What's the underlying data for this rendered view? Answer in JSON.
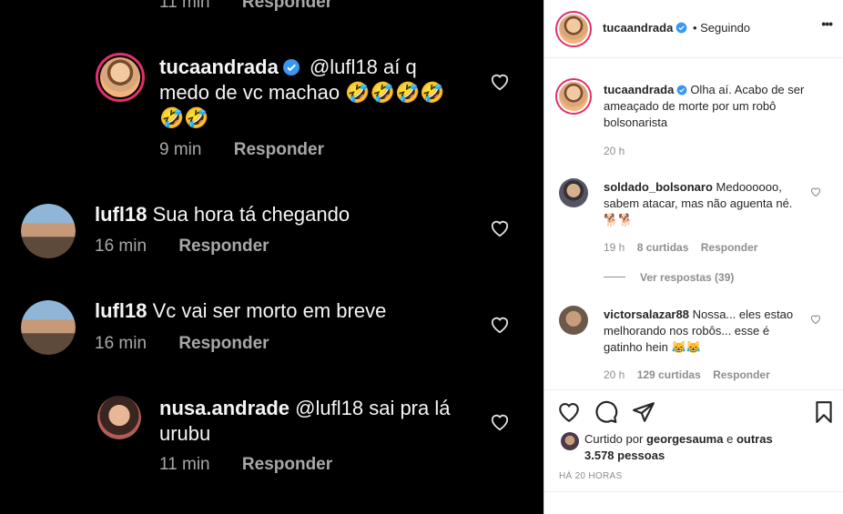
{
  "left": {
    "top_partial": {
      "time": "11 min",
      "reply": "Responder"
    },
    "comments": [
      {
        "username": "tucaandrada",
        "text": "@lufl18 aí q medo de vc machao 🤣🤣🤣🤣🤣🤣",
        "time": "9 min",
        "reply": "Responder"
      },
      {
        "username": "lufl18",
        "text": "Sua hora tá chegando",
        "time": "16 min",
        "reply": "Responder"
      },
      {
        "username": "lufl18",
        "text": "Vc vai ser morto em breve",
        "time": "16 min",
        "reply": "Responder"
      },
      {
        "username": "nusa.andrade",
        "text": "@lufl18 sai pra lá urubu",
        "time": "11 min",
        "reply": "Responder"
      }
    ]
  },
  "panel": {
    "header": {
      "username": "tucaandrada",
      "status": "• Seguindo",
      "more": "•••"
    },
    "caption": {
      "username": "tucaandrada",
      "text": "Olha aí. Acabo de ser ameaçado de morte por um robô bolsonarista",
      "time": "20 h"
    },
    "comments": [
      {
        "username": "soldado_bolsonaro",
        "text": "Medoooooo, sabem atacar, mas não aguenta né. 🐕🐕",
        "time": "19 h",
        "likes": "8 curtidas",
        "reply": "Responder",
        "view_replies": "Ver respostas (39)"
      },
      {
        "username": "victorsalazar88",
        "text": "Nossa... eles estao melhorando nos robôs... esse é gatinho hein 😹😹",
        "time": "20 h",
        "likes": "129 curtidas",
        "reply": "Responder"
      }
    ],
    "likes": {
      "prefix": "Curtido por",
      "user": "georgesauma",
      "suffix": "e",
      "others": "outras 3.578 pessoas"
    },
    "date": "HÁ 20 HORAS"
  },
  "colors": {
    "ring": "#e1306c",
    "verified": "#3897f0",
    "panel_bg": "#ffffff",
    "dark_bg": "#000000"
  }
}
